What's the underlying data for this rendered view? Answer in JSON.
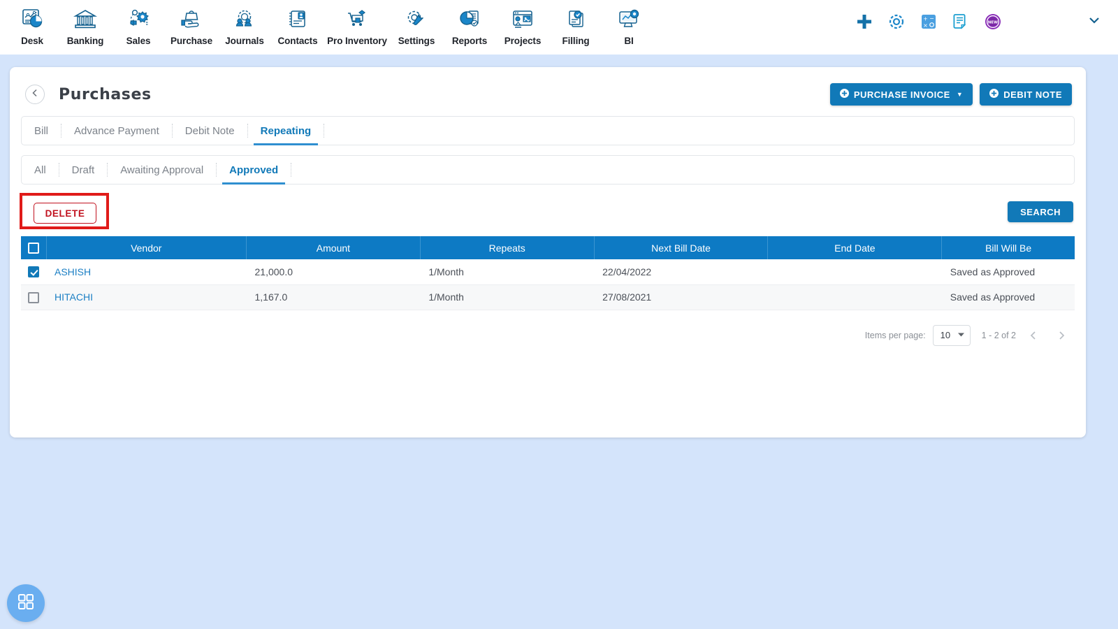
{
  "topnav": {
    "items": [
      {
        "label": "Desk",
        "icon": "dashboard-chart-icon"
      },
      {
        "label": "Banking",
        "icon": "bank-building-icon"
      },
      {
        "label": "Sales",
        "icon": "sales-megaphone-icon"
      },
      {
        "label": "Purchase",
        "icon": "purchase-hand-bag-icon"
      },
      {
        "label": "Journals",
        "icon": "journals-gear-people-icon"
      },
      {
        "label": "Contacts",
        "icon": "contacts-notebook-icon"
      },
      {
        "label": "Pro Inventory",
        "icon": "inventory-cart-icon"
      },
      {
        "label": "Settings",
        "icon": "settings-gear-wrench-icon"
      },
      {
        "label": "Reports",
        "icon": "reports-pie-doc-icon"
      },
      {
        "label": "Projects",
        "icon": "projects-window-icon"
      },
      {
        "label": "Filling",
        "icon": "filling-documents-icon"
      },
      {
        "label": "BI",
        "icon": "bi-monitor-gear-icon"
      }
    ],
    "tools": [
      {
        "name": "add-plus-icon"
      },
      {
        "name": "settings-gear-icon"
      },
      {
        "name": "calculator-icon"
      },
      {
        "name": "notes-document-icon"
      },
      {
        "name": "new-badge-icon",
        "text": "NEW"
      }
    ],
    "expand": {
      "name": "chevron-down-icon"
    }
  },
  "header": {
    "back": "back-chevron-icon",
    "title": "Purchases",
    "purchase_invoice_label": "PURCHASE INVOICE",
    "debit_note_label": "DEBIT NOTE"
  },
  "main_tabs": [
    {
      "label": "Bill",
      "active": false
    },
    {
      "label": "Advance Payment",
      "active": false
    },
    {
      "label": "Debit Note",
      "active": false
    },
    {
      "label": "Repeating",
      "active": true
    }
  ],
  "status_tabs": [
    {
      "label": "All",
      "active": false
    },
    {
      "label": "Draft",
      "active": false
    },
    {
      "label": "Awaiting Approval",
      "active": false
    },
    {
      "label": "Approved",
      "active": true
    }
  ],
  "actions": {
    "delete_label": "DELETE",
    "search_label": "SEARCH",
    "highlight_color": "#e01b19"
  },
  "table": {
    "columns": [
      "Vendor",
      "Amount",
      "Repeats",
      "Next Bill Date",
      "End Date",
      "Bill Will Be"
    ],
    "header_select_all_checked": false,
    "rows": [
      {
        "checked": true,
        "vendor": "ASHISH",
        "amount": "21,000.0",
        "repeats": "1/Month",
        "next_bill_date": "22/04/2022",
        "end_date": "",
        "bill_will_be": "Saved as Approved"
      },
      {
        "checked": false,
        "vendor": "HITACHI",
        "amount": "1,167.0",
        "repeats": "1/Month",
        "next_bill_date": "27/08/2021",
        "end_date": "",
        "bill_will_be": "Saved as Approved"
      }
    ]
  },
  "paginator": {
    "items_per_page_label": "Items per page:",
    "items_per_page_value": "10",
    "range_label": "1 - 2 of 2",
    "prev_icon": "chevron-left-icon",
    "next_icon": "chevron-right-icon"
  },
  "fab": {
    "name": "apps-grid-icon"
  },
  "colors": {
    "page_background": "#d4e4fb",
    "primary_blue": "#1179b8",
    "table_header_blue": "#0d7ac4",
    "delete_red": "#c1121f",
    "link_blue": "#1b7fc4"
  }
}
